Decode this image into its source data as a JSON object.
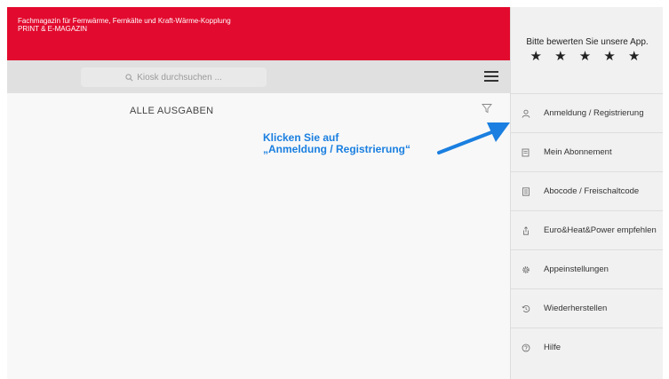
{
  "header": {
    "line1": "Fachmagazin für Fernwärme, Fernkälte und Kraft-Wärme-Kopplung",
    "line2": "PRINT & E-MAGAZIN",
    "background": "#e20a2e"
  },
  "search": {
    "placeholder": "Kiosk durchsuchen ..."
  },
  "main": {
    "section_title": "ALLE AUSGABEN"
  },
  "callout": {
    "line1": "Klicken Sie auf",
    "line2": "„Anmeldung / Registrierung“",
    "color": "#1a7fe0"
  },
  "sidebar": {
    "rate_label": "Bitte bewerten Sie unsere App.",
    "stars": "★ ★ ★ ★ ★",
    "items": [
      {
        "label": "Anmeldung / Registrierung",
        "icon": "user-icon"
      },
      {
        "label": "Mein Abonnement",
        "icon": "subscription-icon"
      },
      {
        "label": "Abocode / Freischaltcode",
        "icon": "code-icon"
      },
      {
        "label": "Euro&Heat&Power empfehlen",
        "icon": "share-icon"
      },
      {
        "label": "Appeinstellungen",
        "icon": "gear-icon"
      },
      {
        "label": "Wiederherstellen",
        "icon": "restore-icon"
      },
      {
        "label": "Hilfe",
        "icon": "help-icon"
      }
    ]
  }
}
